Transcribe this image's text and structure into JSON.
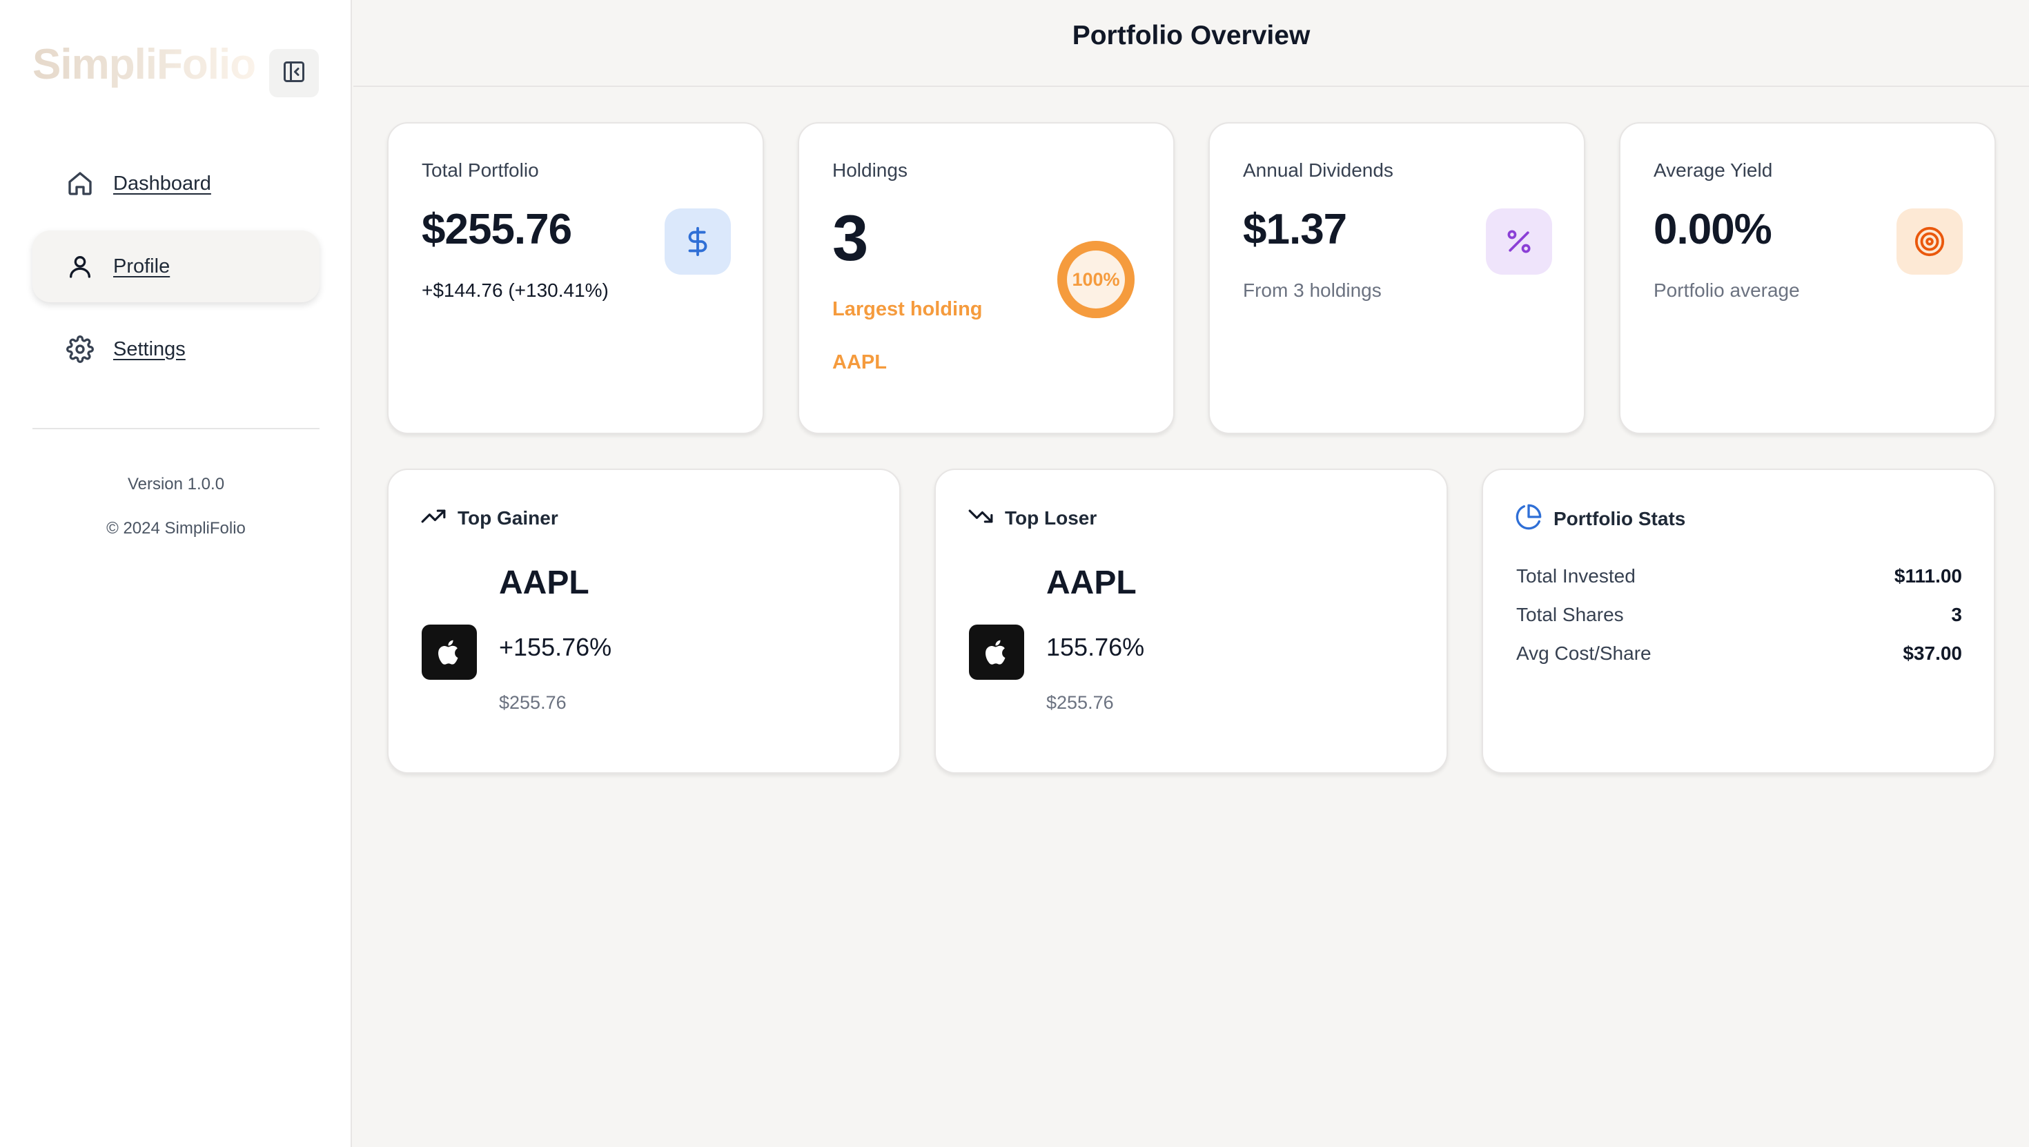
{
  "sidebar": {
    "logo": "SimpliFolio",
    "items": [
      {
        "label": "Dashboard",
        "icon": "home-icon"
      },
      {
        "label": "Profile",
        "icon": "user-icon",
        "active": true
      },
      {
        "label": "Settings",
        "icon": "gear-icon"
      }
    ],
    "version": "Version 1.0.0",
    "copyright": "© 2024 SimpliFolio"
  },
  "header": {
    "title": "Portfolio Overview"
  },
  "summary": {
    "total_portfolio": {
      "label": "Total Portfolio",
      "value": "$255.76",
      "change": "+$144.76 (+130.41%)",
      "icon": "dollar-icon"
    },
    "holdings": {
      "label": "Holdings",
      "value": "3",
      "largest_label": "Largest holding",
      "largest_symbol": "AAPL",
      "ring_text": "100%",
      "ring_fraction": 1.0
    },
    "annual_dividends": {
      "label": "Annual Dividends",
      "value": "$1.37",
      "sub": "From 3 holdings",
      "icon": "percent-icon"
    },
    "average_yield": {
      "label": "Average Yield",
      "value": "0.00%",
      "sub": "Portfolio average",
      "icon": "target-icon"
    }
  },
  "top_gainer": {
    "title": "Top Gainer",
    "symbol": "AAPL",
    "change": "+155.76%",
    "price": "$255.76",
    "icon": "trending-up-icon"
  },
  "top_loser": {
    "title": "Top Loser",
    "symbol": "AAPL",
    "change": "155.76%",
    "price": "$255.76",
    "icon": "trending-down-icon"
  },
  "portfolio_stats": {
    "title": "Portfolio Stats",
    "icon": "pie-chart-icon",
    "rows": [
      {
        "label": "Total Invested",
        "value": "$111.00"
      },
      {
        "label": "Total Shares",
        "value": "3"
      },
      {
        "label": "Avg Cost/Share",
        "value": "$37.00"
      }
    ]
  },
  "colors": {
    "accent_orange": "#f59b3d",
    "blue": "#2f6fd6",
    "purple": "#8b3fd6",
    "orange_icon": "#ea580c"
  }
}
